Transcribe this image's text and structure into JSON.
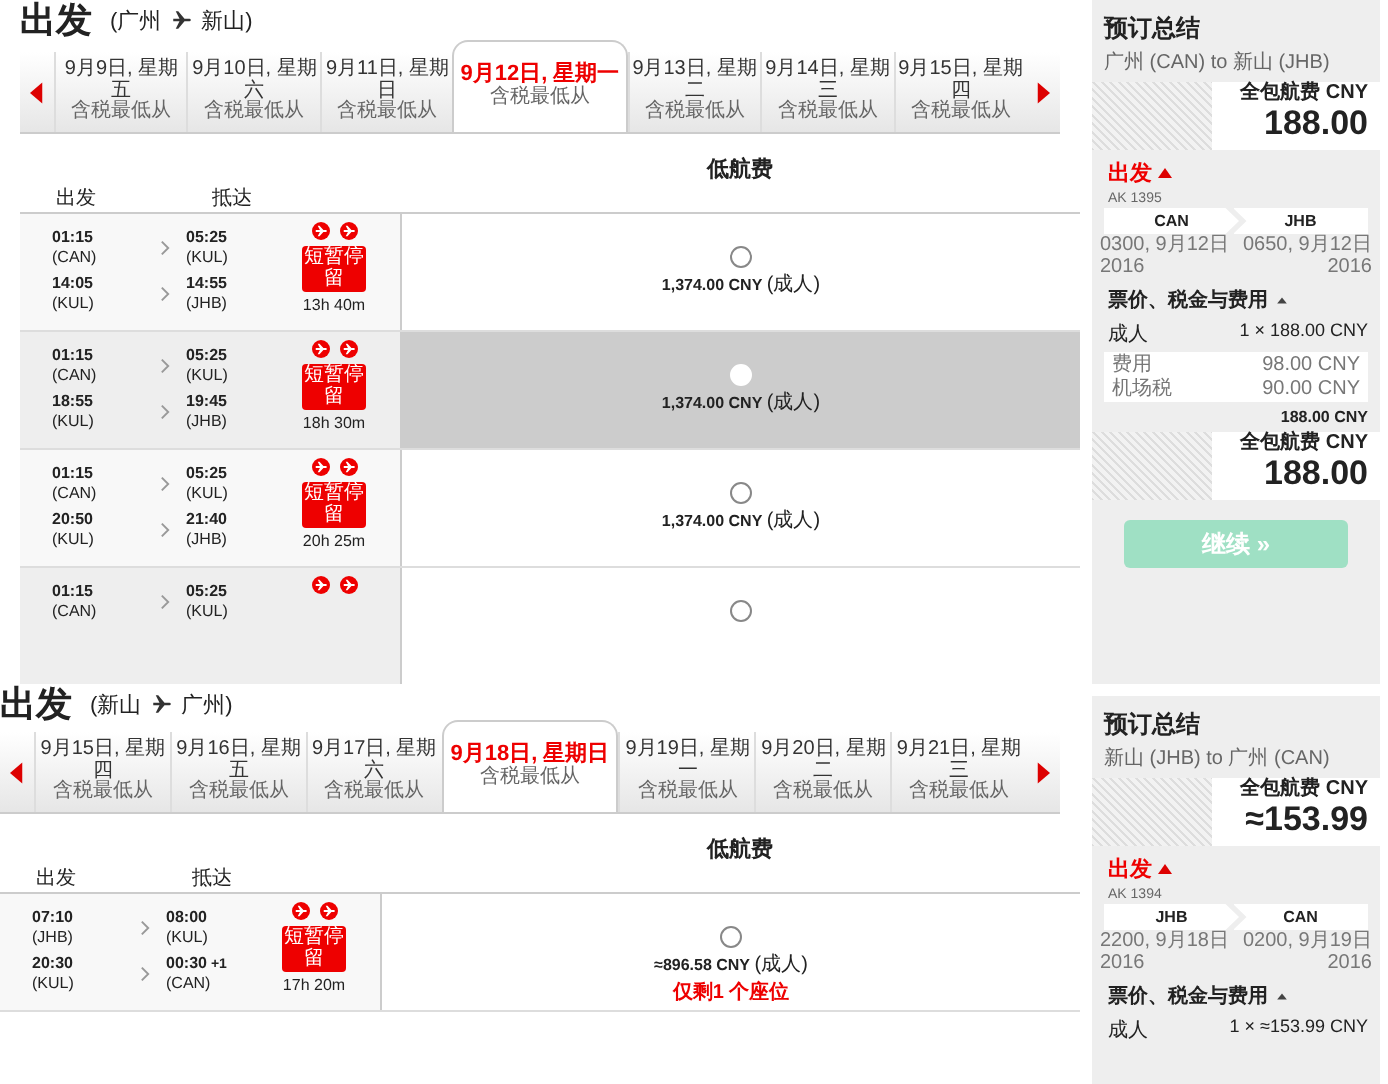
{
  "sections": [
    {
      "heading": "出发",
      "route_from": "(广州",
      "route_to": "新山)",
      "dates": [
        {
          "date": "9月9日, 星期五",
          "sub": "含税最低从",
          "selected": false
        },
        {
          "date": "9月10日, 星期六",
          "sub": "含税最低从",
          "selected": false
        },
        {
          "date": "9月11日, 星期日",
          "sub": "含税最低从",
          "selected": false
        },
        {
          "date": "9月12日, 星期一",
          "sub": "含税最低从",
          "selected": true
        },
        {
          "date": "9月13日, 星期二",
          "sub": "含税最低从",
          "selected": false
        },
        {
          "date": "9月14日, 星期三",
          "sub": "含税最低从",
          "selected": false
        },
        {
          "date": "9月15日, 星期四",
          "sub": "含税最低从",
          "selected": false
        }
      ],
      "fare_header": "低航费",
      "columns": [
        "出发",
        "抵达"
      ],
      "flights": [
        {
          "segments": [
            {
              "dep_time": "01:15",
              "dep_code": "(CAN)",
              "arr_time": "05:25",
              "arr_code": "(KUL)"
            },
            {
              "dep_time": "14:05",
              "dep_code": "(KUL)",
              "arr_time": "14:55",
              "arr_code": "(JHB)"
            }
          ],
          "badge": "短暂停留",
          "duration": "13h 40m",
          "price": "1,374.00 CNY",
          "pax": "(成人)",
          "selected": false
        },
        {
          "segments": [
            {
              "dep_time": "01:15",
              "dep_code": "(CAN)",
              "arr_time": "05:25",
              "arr_code": "(KUL)"
            },
            {
              "dep_time": "18:55",
              "dep_code": "(KUL)",
              "arr_time": "19:45",
              "arr_code": "(JHB)"
            }
          ],
          "badge": "短暂停留",
          "duration": "18h 30m",
          "price": "1,374.00 CNY",
          "pax": "(成人)",
          "selected": true
        },
        {
          "segments": [
            {
              "dep_time": "01:15",
              "dep_code": "(CAN)",
              "arr_time": "05:25",
              "arr_code": "(KUL)"
            },
            {
              "dep_time": "20:50",
              "dep_code": "(KUL)",
              "arr_time": "21:40",
              "arr_code": "(JHB)"
            }
          ],
          "badge": "短暂停留",
          "duration": "20h 25m",
          "price": "1,374.00 CNY",
          "pax": "(成人)",
          "selected": false
        },
        {
          "segments": [
            {
              "dep_time": "01:15",
              "dep_code": "(CAN)",
              "arr_time": "05:25",
              "arr_code": "(KUL)"
            }
          ],
          "selected": false
        }
      ],
      "summary": {
        "title": "预订总结",
        "route": "广州 (CAN) to 新山 (JHB)",
        "price_label": "全包航费 CNY",
        "price": "188.00",
        "direction": "出发",
        "direction_expanded": true,
        "flight_no": "AK 1395",
        "from": "CAN",
        "to": "JHB",
        "dep": "0300, 9月12日 2016",
        "arr": "0650, 9月12日 2016",
        "fares_label": "票价、税金与费用",
        "fares_expanded": true,
        "pax_label": "成人",
        "pax_amount": "1 × 188.00 CNY",
        "breakdown": [
          {
            "label": "费用",
            "amount": "98.00 CNY"
          },
          {
            "label": "机场税",
            "amount": "90.00 CNY"
          }
        ],
        "total": "188.00 CNY",
        "price_label_2": "全包航费 CNY",
        "price_2": "188.00",
        "button": {
          "label": "继续 »",
          "disabled": true
        }
      }
    },
    {
      "heading": "出发",
      "route_from": "(新山",
      "route_to": "广州)",
      "dates": [
        {
          "date": "9月15日, 星期四",
          "sub": "含税最低从",
          "selected": false
        },
        {
          "date": "9月16日, 星期五",
          "sub": "含税最低从",
          "selected": false
        },
        {
          "date": "9月17日, 星期六",
          "sub": "含税最低从",
          "selected": false
        },
        {
          "date": "9月18日, 星期日",
          "sub": "含税最低从",
          "selected": true
        },
        {
          "date": "9月19日, 星期一",
          "sub": "含税最低从",
          "selected": false
        },
        {
          "date": "9月20日, 星期二",
          "sub": "含税最低从",
          "selected": false
        },
        {
          "date": "9月21日, 星期三",
          "sub": "含税最低从",
          "selected": false
        }
      ],
      "fare_header": "低航费",
      "columns": [
        "出发",
        "抵达"
      ],
      "flights": [
        {
          "segments": [
            {
              "dep_time": "07:10",
              "dep_code": "(JHB)",
              "arr_time": "08:00",
              "arr_code": "(KUL)"
            },
            {
              "dep_time": "20:30",
              "dep_code": "(KUL)",
              "arr_time": "00:30",
              "arr_offset": "+1",
              "arr_code": "(CAN)"
            }
          ],
          "badge": "短暂停留",
          "duration": "17h 20m",
          "price": "≈896.58 CNY",
          "pax": "(成人)",
          "note": "仅剩1 个座位",
          "selected": false
        }
      ],
      "summary": {
        "title": "预订总结",
        "route": "新山 (JHB) to 广州 (CAN)",
        "price_label": "全包航费 CNY",
        "price": "≈153.99",
        "direction": "出发",
        "direction_expanded": true,
        "flight_no": "AK 1394",
        "from": "JHB",
        "to": "CAN",
        "dep": "2200, 9月18日 2016",
        "arr": "0200, 9月19日 2016",
        "fares_label": "票价、税金与费用",
        "fares_expanded": true,
        "pax_label": "成人",
        "pax_amount": "1 × ≈153.99 CNY"
      }
    }
  ]
}
